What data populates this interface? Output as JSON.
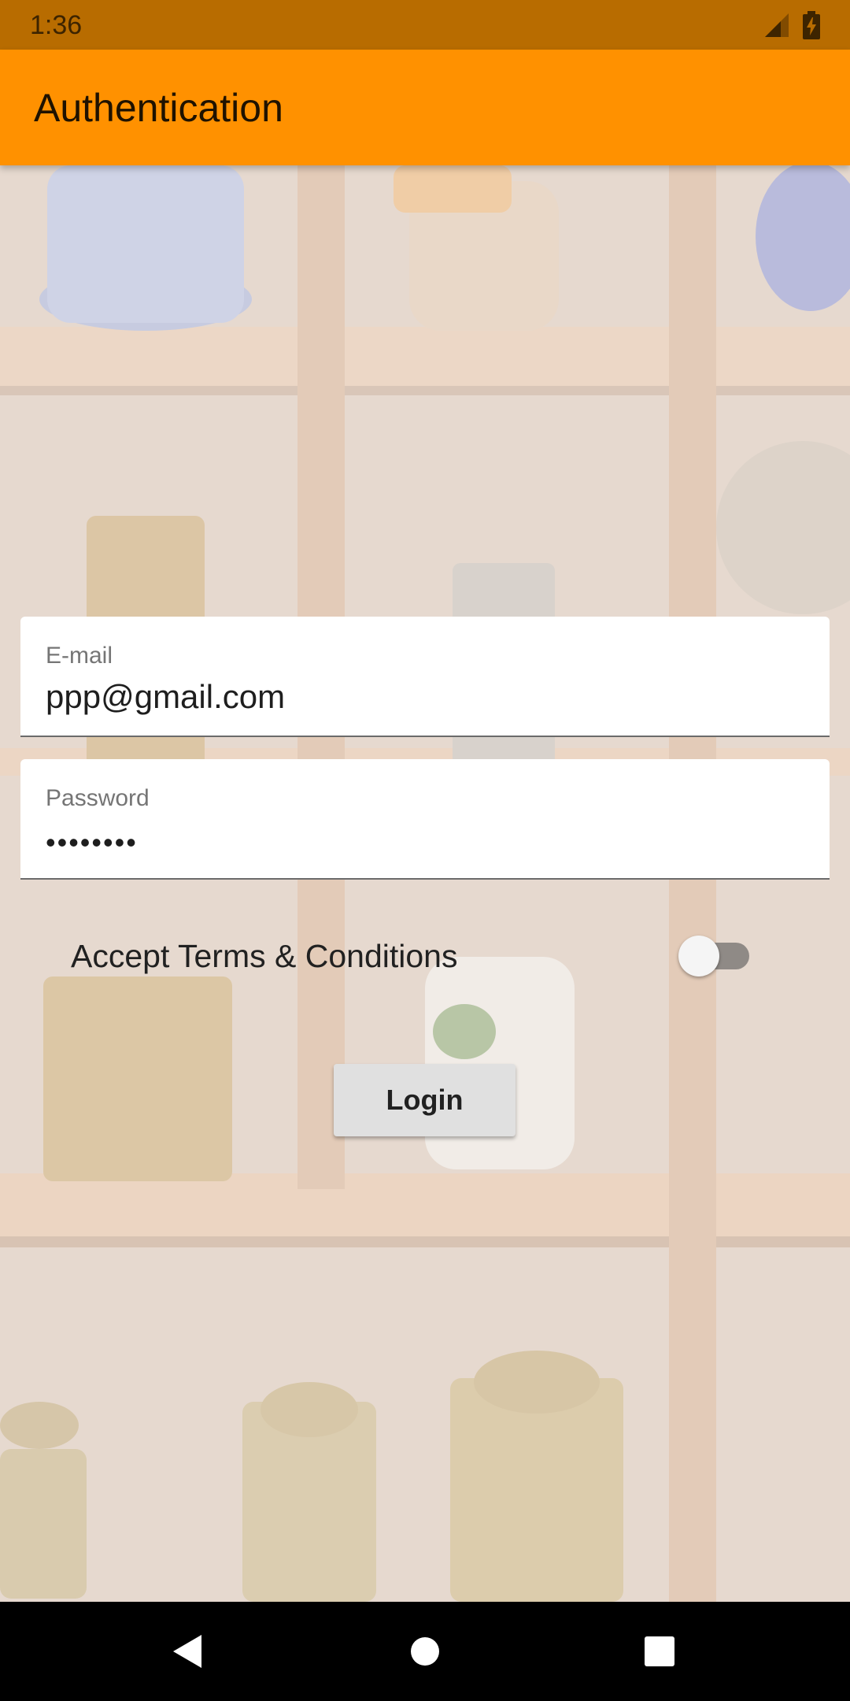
{
  "status_bar": {
    "time": "1:36",
    "icons": [
      "signal-icon",
      "battery-charging-icon"
    ]
  },
  "app_bar": {
    "title": "Authentication",
    "color": "#ff9100"
  },
  "form": {
    "email": {
      "label": "E-mail",
      "value": "ppp@gmail.com"
    },
    "password": {
      "label": "Password",
      "masked_value": "••••••••"
    },
    "terms": {
      "label": "Accept Terms & Conditions",
      "checked": false
    },
    "login_label": "Login"
  },
  "nav_bar": {
    "buttons": [
      "back-icon",
      "home-icon",
      "recents-icon"
    ]
  }
}
